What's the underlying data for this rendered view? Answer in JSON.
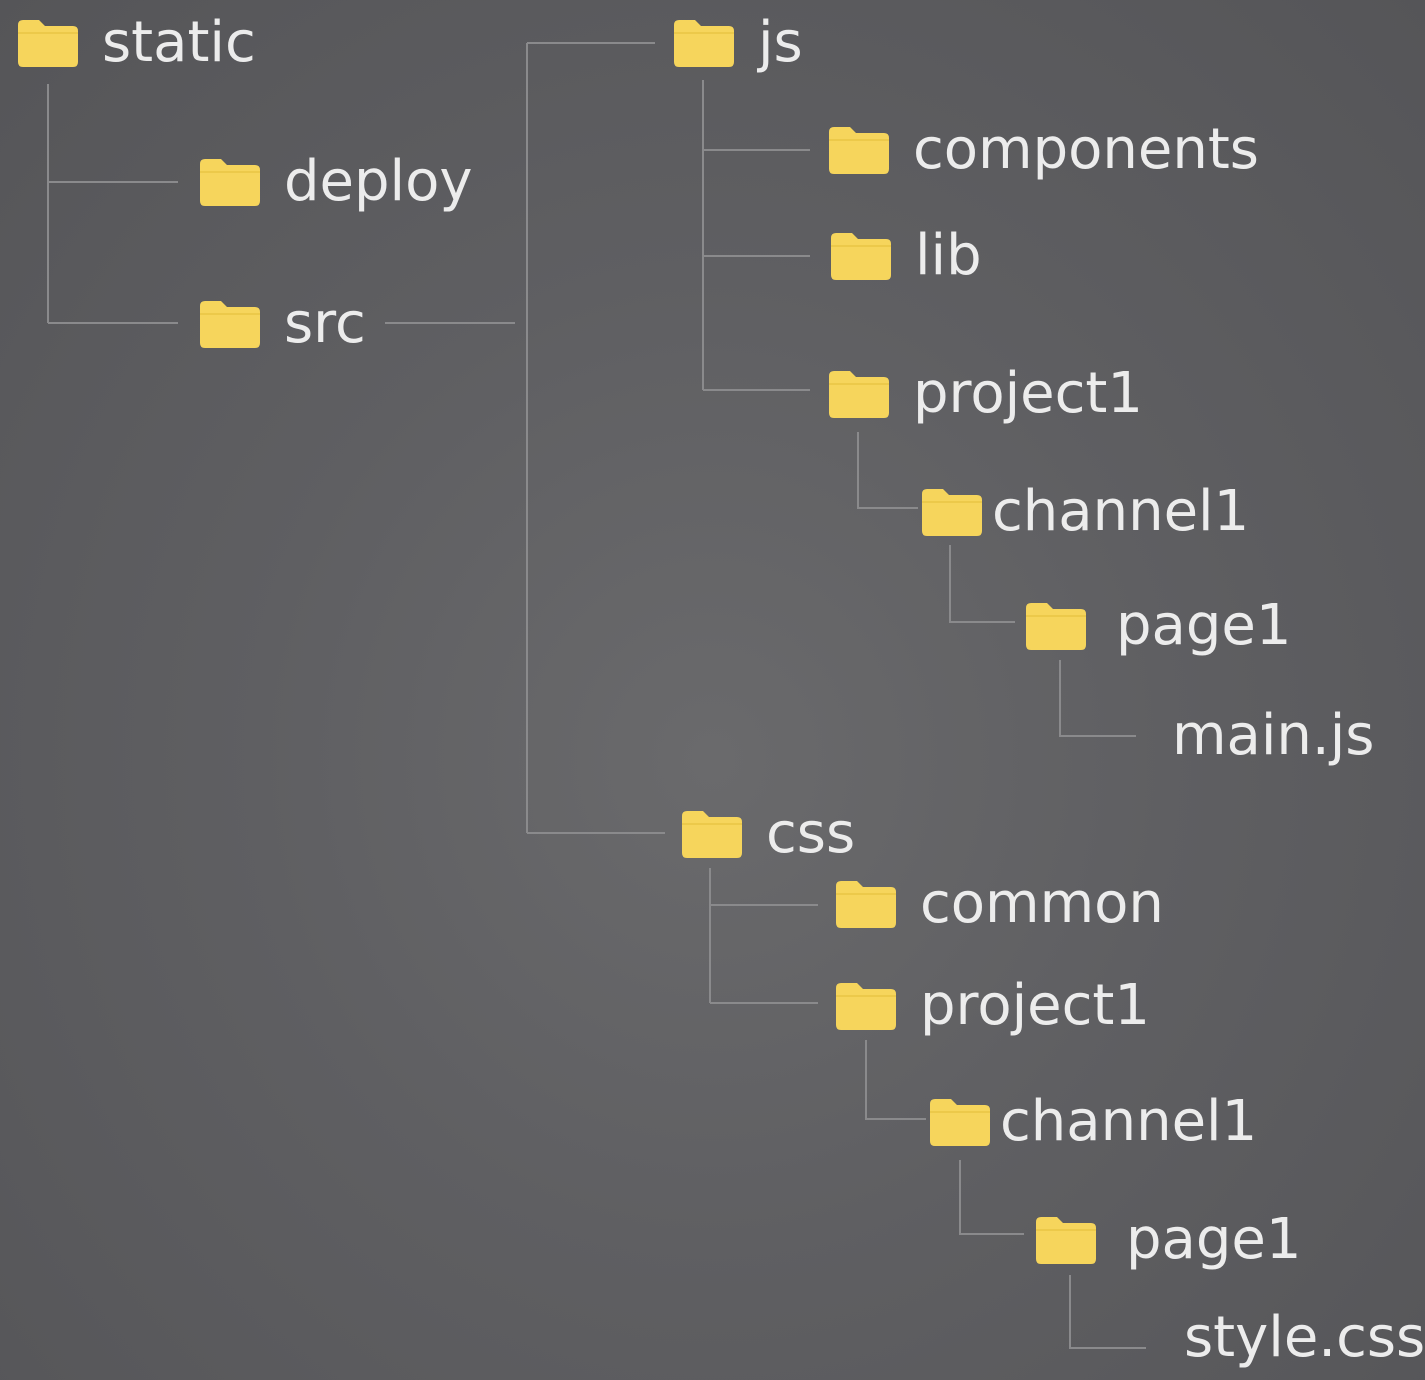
{
  "folder_color": "#f6d55c",
  "line_color": "#8a8a8c",
  "icon": "folder-icon",
  "tree": {
    "static": "static",
    "deploy": "deploy",
    "src": "src",
    "js": "js",
    "js_components": "components",
    "js_lib": "lib",
    "js_project1": "project1",
    "js_channel1": "channel1",
    "js_page1": "page1",
    "main_js": "main.js",
    "css": "css",
    "css_common": "common",
    "css_project1": "project1",
    "css_channel1": "channel1",
    "css_page1": "page1",
    "style_css": "style.css"
  }
}
